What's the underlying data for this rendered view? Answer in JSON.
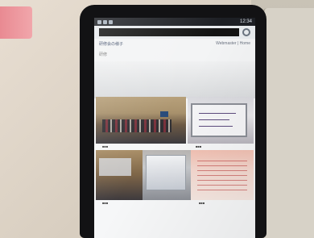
{
  "status_bar": {
    "clock": "12:34",
    "icons": [
      "signal-icon",
      "wifi-icon",
      "battery-icon"
    ]
  },
  "browser": {
    "url_text": "",
    "refresh_icon": "refresh-icon"
  },
  "page": {
    "header_title": "研修会の様子",
    "header_nav": "Webmaster | Home",
    "breadcrumb": "研修",
    "captions": [
      "■■■",
      "■■■",
      "■■■",
      "■■■"
    ]
  },
  "colors": {
    "desk": "#ddd3c6",
    "tablet_bezel": "#121214",
    "screen_bg": "#f6f7f8",
    "status_bar_bg": "#1d1f24"
  }
}
